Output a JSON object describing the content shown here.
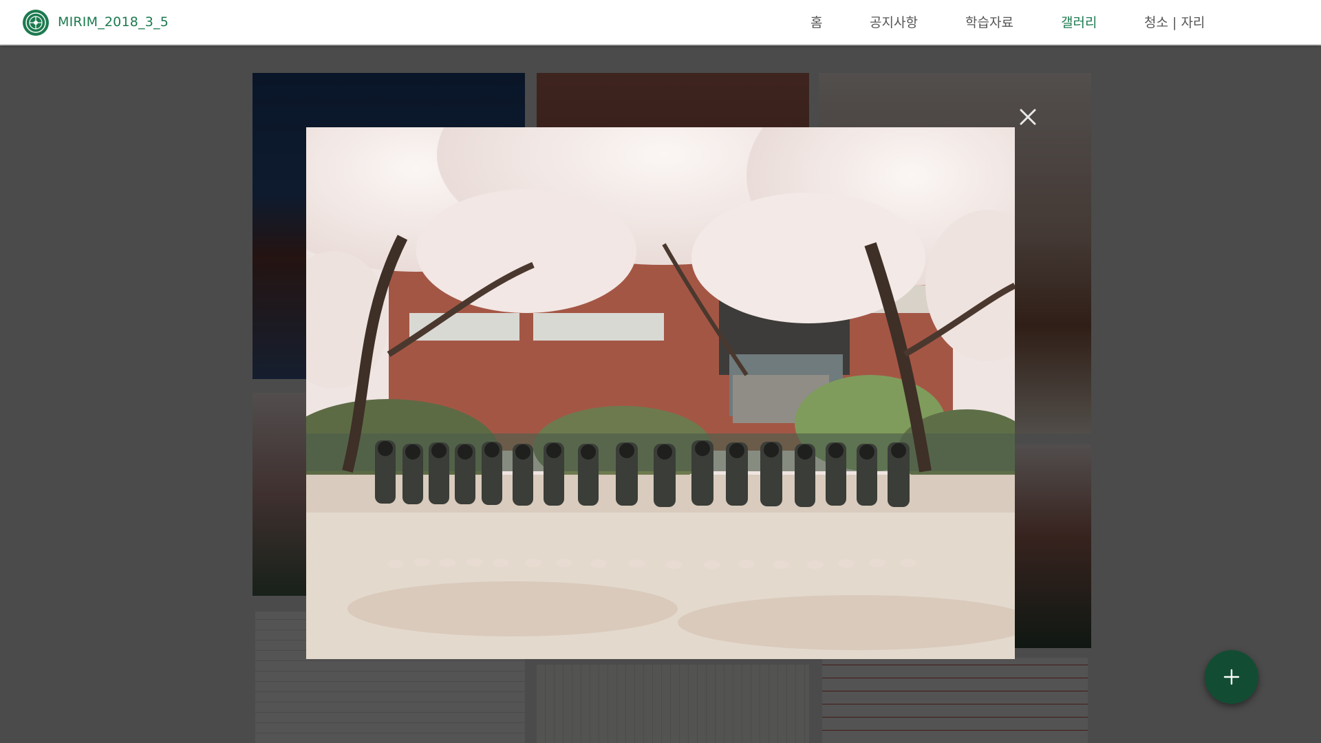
{
  "header": {
    "site_title": "MIRIM_2018_3_5",
    "logo_icon": "school-emblem-icon"
  },
  "nav": {
    "items": [
      {
        "label": "홈",
        "active": false
      },
      {
        "label": "공지사항",
        "active": false
      },
      {
        "label": "학습자료",
        "active": false
      },
      {
        "label": "갤러리",
        "active": true
      },
      {
        "label": "청소 | 자리",
        "active": false
      }
    ]
  },
  "lightbox": {
    "close_icon": "close-icon",
    "photo_subject": "cherry-blossom-class-photo"
  },
  "fab": {
    "icon": "plus-icon"
  },
  "colors": {
    "brand_green": "#1c7a4f",
    "fab_green": "#124d33",
    "nav_text": "#555555",
    "overlay": "rgba(0,0,0,0.66)"
  }
}
